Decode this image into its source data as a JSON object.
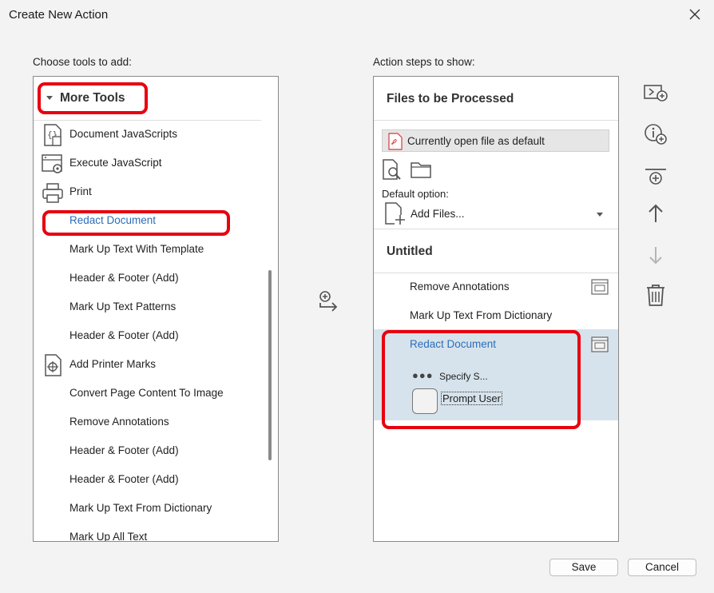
{
  "window": {
    "title": "Create New Action"
  },
  "left": {
    "label": "Choose tools to add:",
    "group": "More Tools",
    "tools": [
      {
        "label": "Document JavaScripts",
        "icon": "document-javascript-icon"
      },
      {
        "label": "Execute JavaScript",
        "icon": "execute-javascript-icon"
      },
      {
        "label": "Print",
        "icon": "printer-icon"
      },
      {
        "label": "Redact Document",
        "icon": ""
      },
      {
        "label": "Mark Up Text With Template",
        "icon": ""
      },
      {
        "label": "Header & Footer (Add)",
        "icon": ""
      },
      {
        "label": "Mark Up Text Patterns",
        "icon": ""
      },
      {
        "label": "Header & Footer (Add)",
        "icon": ""
      },
      {
        "label": "Add Printer Marks",
        "icon": "printer-marks-icon"
      },
      {
        "label": "Convert Page Content To Image",
        "icon": ""
      },
      {
        "label": "Remove Annotations",
        "icon": ""
      },
      {
        "label": "Header & Footer (Add)",
        "icon": ""
      },
      {
        "label": "Header & Footer (Add)",
        "icon": ""
      },
      {
        "label": "Mark Up Text From Dictionary",
        "icon": ""
      },
      {
        "label": "Mark Up All Text",
        "icon": ""
      }
    ],
    "selected_index": 3
  },
  "right": {
    "label": "Action steps to show:",
    "files_header": "Files to be Processed",
    "default_file": "Currently open file as default",
    "default_option_label": "Default option:",
    "add_files": "Add Files...",
    "untitled": "Untitled",
    "steps": [
      {
        "label": "Remove Annotations"
      },
      {
        "label": "Mark Up Text From Dictionary"
      },
      {
        "label": "Redact Document"
      }
    ],
    "specify": "Specify S...",
    "prompt_user": "Prompt User"
  },
  "buttons": {
    "save": "Save",
    "cancel": "Cancel"
  },
  "colors": {
    "annotation": "#e8000f",
    "link_blue": "#2a6ebb",
    "selected_bg": "#d7e3ec"
  }
}
